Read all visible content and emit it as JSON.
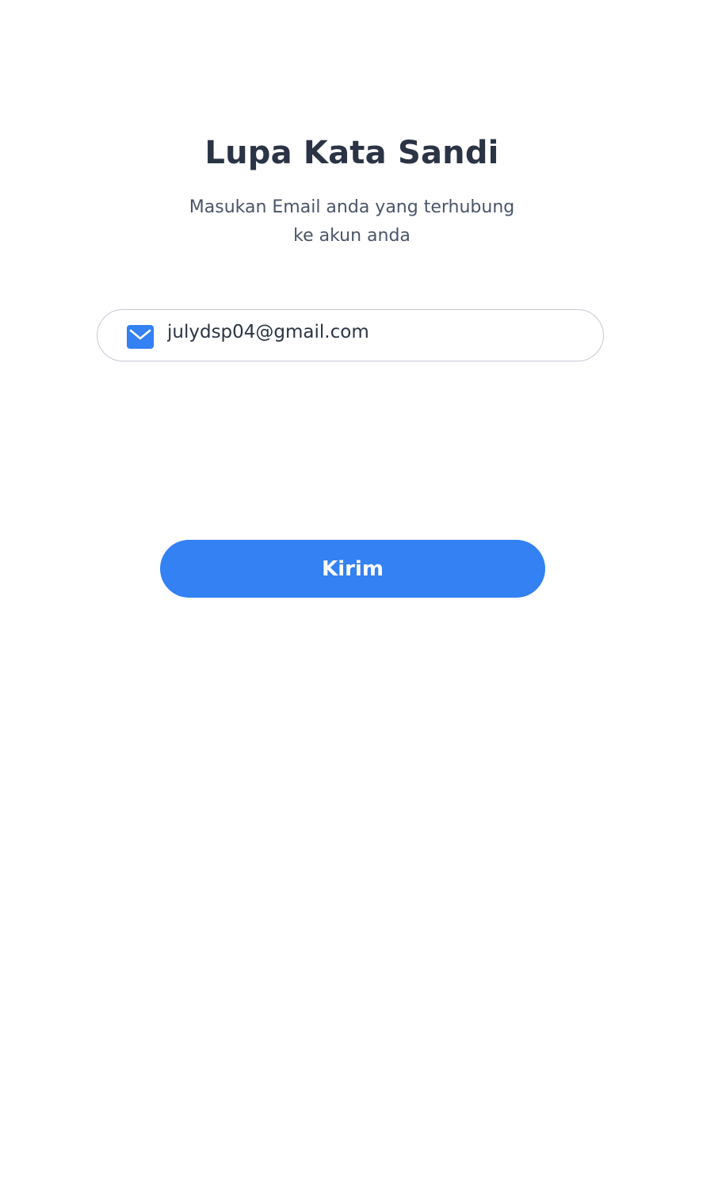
{
  "page": {
    "title": "Lupa Kata Sandi",
    "subtitle_line1": "Masukan Email anda yang terhubung",
    "subtitle_line2": "ke akun anda"
  },
  "email_field": {
    "value": "julydsp04@gmail.com",
    "icon": "mail-icon"
  },
  "submit_button": {
    "label": "Kirim"
  },
  "colors": {
    "accent": "#3381f2",
    "title_text": "#2b3445",
    "body_text": "#4a5568",
    "field_border": "#c3c9d6"
  }
}
